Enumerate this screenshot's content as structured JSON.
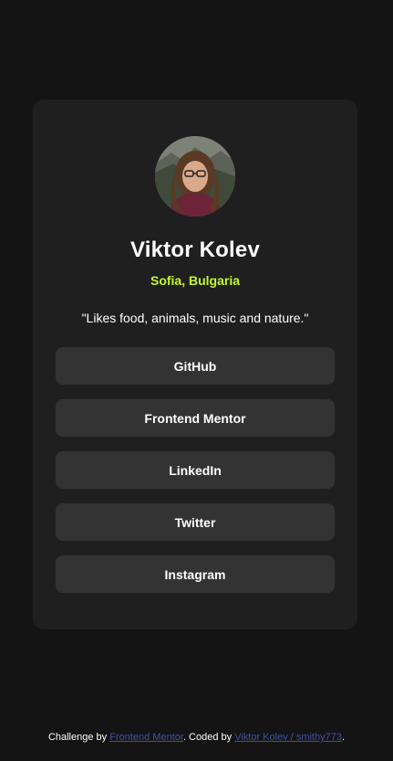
{
  "profile": {
    "avatar_alt": "Profile photo",
    "name": "Viktor Kolev",
    "location": "Sofia, Bulgaria",
    "bio": "\"Likes food, animals, music and nature.\""
  },
  "links": [
    {
      "label": "GitHub"
    },
    {
      "label": "Frontend Mentor"
    },
    {
      "label": "LinkedIn"
    },
    {
      "label": "Twitter"
    },
    {
      "label": "Instagram"
    }
  ],
  "footer": {
    "prefix": "Challenge by ",
    "challenge_link": "Frontend Mentor",
    "middle": ". Coded by ",
    "author_link": "Viktor Kolev / smithy773",
    "suffix": "."
  },
  "colors": {
    "background": "#141414",
    "card": "#1f1f1f",
    "button": "#333333",
    "accent": "#c4f82a",
    "footer_link": "#3e52a3"
  }
}
